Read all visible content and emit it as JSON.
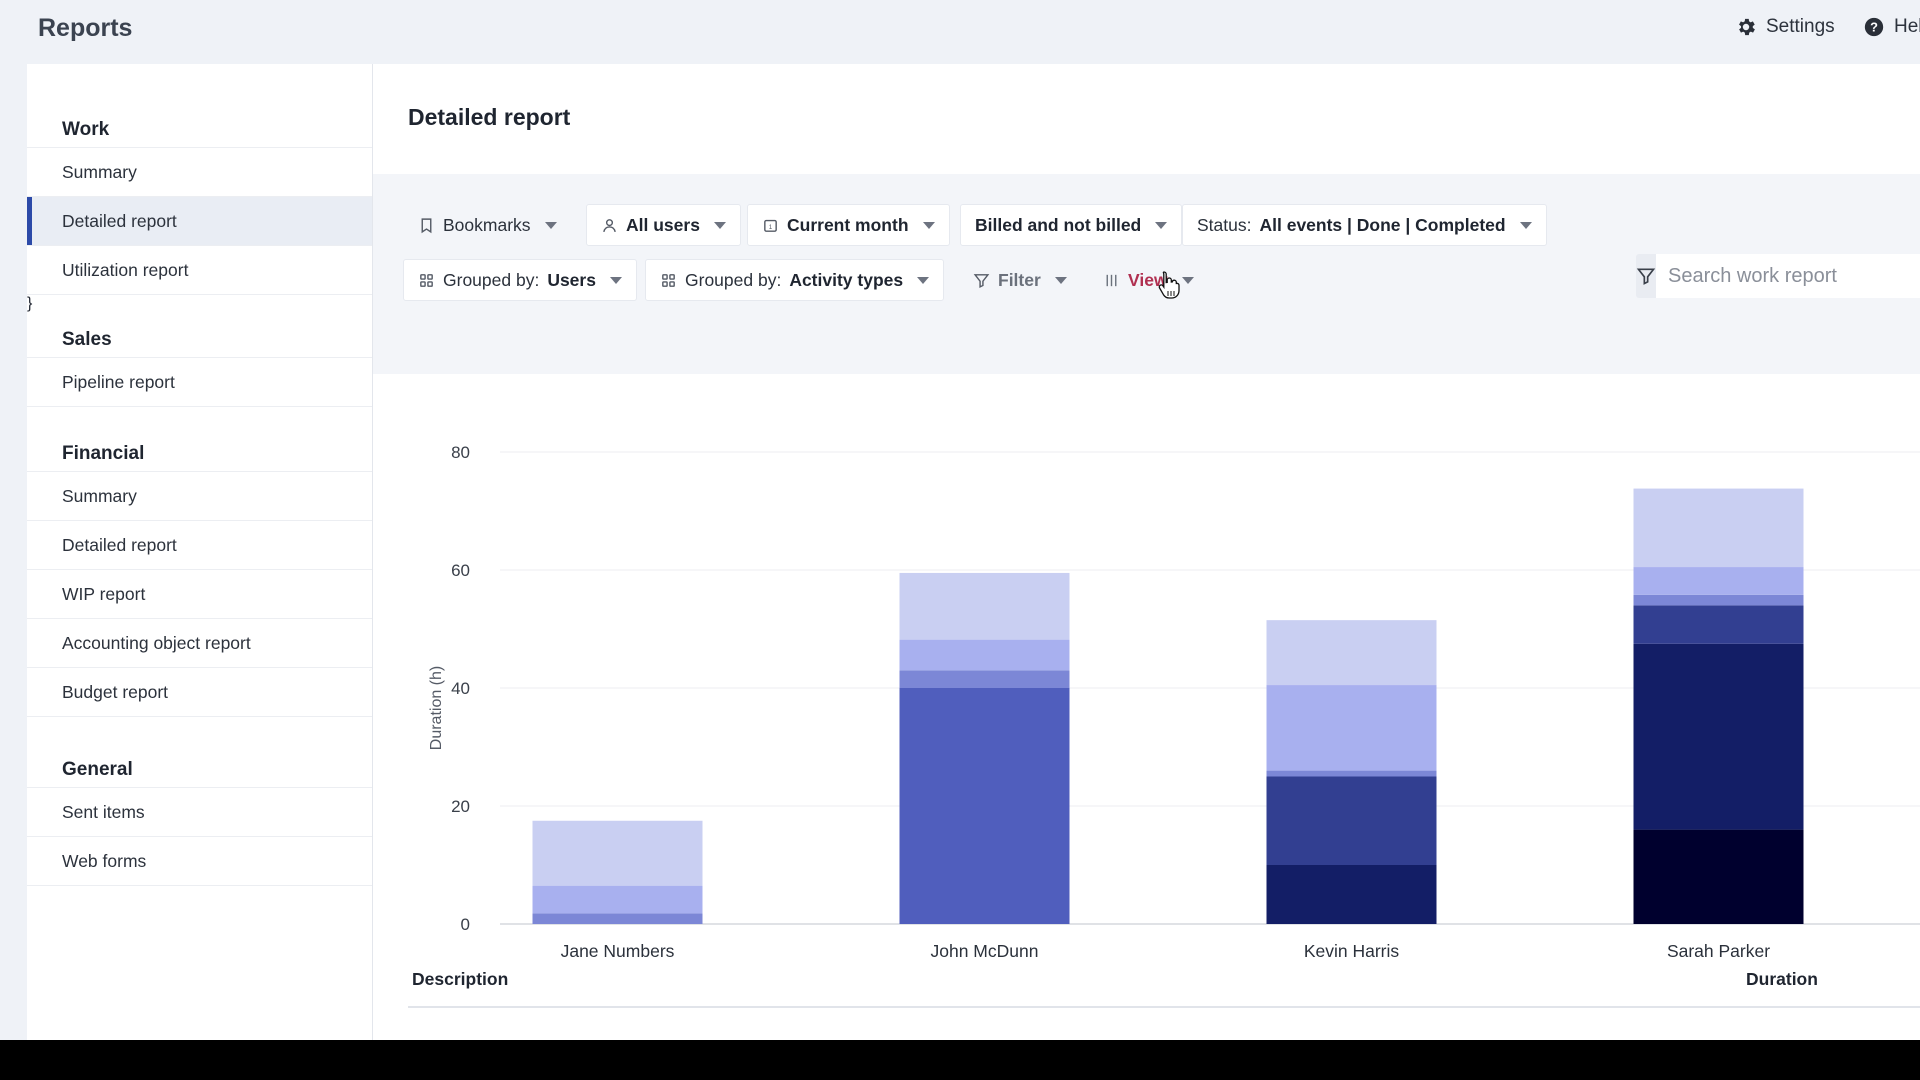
{
  "app": {
    "title": "Reports"
  },
  "topbar": {
    "settings_label": "Settings",
    "help_label": "Hel"
  },
  "sidebar": {
    "sections": [
      {
        "title": "Work",
        "items": [
          {
            "label": "Summary",
            "active": false
          },
          {
            "label": "Detailed report",
            "active": true
          },
          {
            "label": "Utilization report",
            "active": false
          }
        ]
      },
      {
        "title": "Sales",
        "items": [
          {
            "label": "Pipeline report",
            "active": false
          }
        ]
      },
      {
        "title": "Financial",
        "items": [
          {
            "label": "Summary",
            "active": false
          },
          {
            "label": "Detailed report",
            "active": false
          },
          {
            "label": "WIP report",
            "active": false
          },
          {
            "label": "Accounting object report",
            "active": false
          },
          {
            "label": "Budget report",
            "active": false
          }
        ]
      },
      {
        "title": "General",
        "items": [
          {
            "label": "Sent items",
            "active": false
          },
          {
            "label": "Web forms",
            "active": false
          }
        ]
      }
    ]
  },
  "main": {
    "title": "Detailed report",
    "filters": {
      "bookmarks": "Bookmarks",
      "users": "All users",
      "period": "Current month",
      "billing": "Billed and not billed",
      "status_prefix": "Status:",
      "status_value": "All events | Done | Completed",
      "group1_prefix": "Grouped by:",
      "group1_value": "Users",
      "group2_prefix": "Grouped by:",
      "group2_value": "Activity types",
      "filter": "Filter",
      "view": "View"
    },
    "search": {
      "placeholder": "Search work report"
    },
    "table": {
      "col_description": "Description",
      "col_duration": "Duration"
    }
  },
  "colors": {
    "accent": "#2c4aa8",
    "view_link": "#b03051",
    "segments": [
      "#00002e",
      "#131e66",
      "#323f91",
      "#505ebd",
      "#7c87d6",
      "#a8b0ef",
      "#c9cff2"
    ]
  },
  "chart_data": {
    "type": "bar",
    "stacked": true,
    "categories": [
      "Jane Numbers",
      "John McDunn",
      "Kevin Harris",
      "Sarah Parker"
    ],
    "series": [
      {
        "values": [
          0,
          0,
          0,
          16
        ]
      },
      {
        "values": [
          0,
          0,
          10,
          31.5
        ]
      },
      {
        "values": [
          0,
          0,
          15,
          6.5
        ]
      },
      {
        "values": [
          0,
          40,
          0,
          0
        ]
      },
      {
        "values": [
          1.8,
          3,
          1,
          1.8
        ]
      },
      {
        "values": [
          4.7,
          5.2,
          14.5,
          4.7
        ]
      },
      {
        "values": [
          11,
          11.3,
          11,
          13.3
        ]
      }
    ],
    "ylabel": "Duration (h)",
    "yticks": [
      0,
      20,
      40,
      60,
      80
    ],
    "ylim": [
      0,
      80
    ],
    "grid": true,
    "legend": "none"
  }
}
